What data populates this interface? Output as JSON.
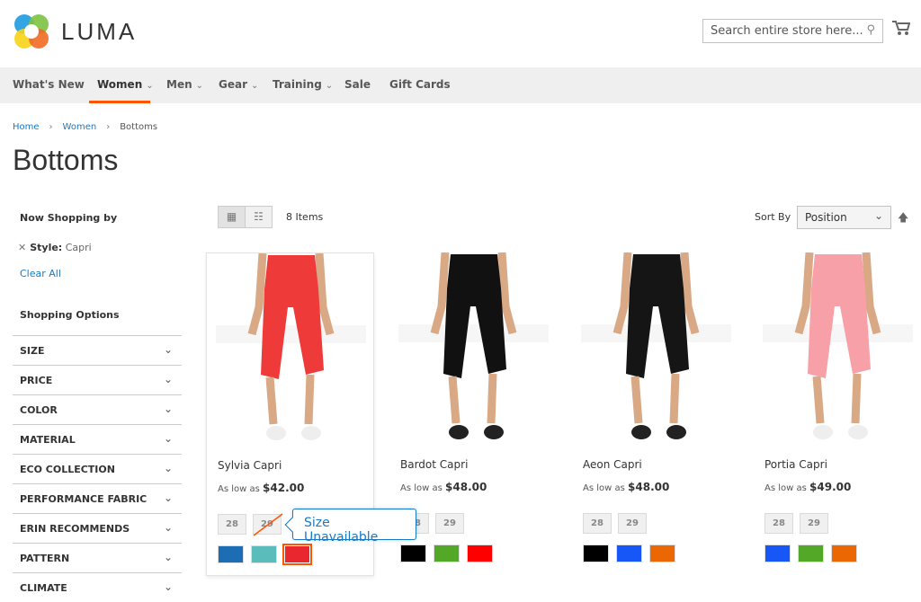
{
  "header": {
    "logo": "LUMA",
    "search_placeholder": "Search entire store here..."
  },
  "nav": [
    {
      "label": "What's New"
    },
    {
      "label": "Women",
      "active": true,
      "dropdown": true
    },
    {
      "label": "Men",
      "dropdown": true
    },
    {
      "label": "Gear",
      "dropdown": true
    },
    {
      "label": "Training",
      "dropdown": true
    },
    {
      "label": "Sale"
    },
    {
      "label": "Gift Cards"
    }
  ],
  "breadcrumb": [
    "Home",
    "Women",
    "Bottoms"
  ],
  "page_title": "Bottoms",
  "sidebar": {
    "now_shopping": "Now Shopping by",
    "active_filter": {
      "name": "Style:",
      "value": "Capri"
    },
    "clear_all": "Clear All",
    "options_title": "Shopping Options",
    "filters": [
      "SIZE",
      "PRICE",
      "COLOR",
      "MATERIAL",
      "ECO COLLECTION",
      "PERFORMANCE FABRIC",
      "ERIN RECOMMENDS",
      "PATTERN",
      "CLIMATE"
    ]
  },
  "toolbar": {
    "count": "8 Items",
    "sort_label": "Sort By",
    "sort_value": "Position"
  },
  "accent": "#ff5501",
  "link_color": "#1979c3",
  "products": [
    {
      "name": "Sylvia Capri",
      "price_prefix": "As low as",
      "price": "$42.00",
      "sizes": [
        "28",
        "29"
      ],
      "swatches": [
        "#1d6db5",
        "#5bbcbc",
        "#e8282e"
      ],
      "pants": "#ef3a3a"
    },
    {
      "name": "Bardot Capri",
      "price_prefix": "As low as",
      "price": "$48.00",
      "sizes": [
        "28",
        "29"
      ],
      "swatches": [
        "#000000",
        "#53a828",
        "#ff0000"
      ],
      "pants": "#111111"
    },
    {
      "name": "Aeon Capri",
      "price_prefix": "As low as",
      "price": "$48.00",
      "sizes": [
        "28",
        "29"
      ],
      "swatches": [
        "#000000",
        "#1857f7",
        "#eb6703"
      ],
      "pants": "#151515"
    },
    {
      "name": "Portia Capri",
      "price_prefix": "As low as",
      "price": "$49.00",
      "sizes": [
        "28",
        "29"
      ],
      "swatches": [
        "#1857f7",
        "#53a828",
        "#eb6703"
      ],
      "pants": "#f7a0a8"
    }
  ],
  "tooltip": "Size Unavailable"
}
